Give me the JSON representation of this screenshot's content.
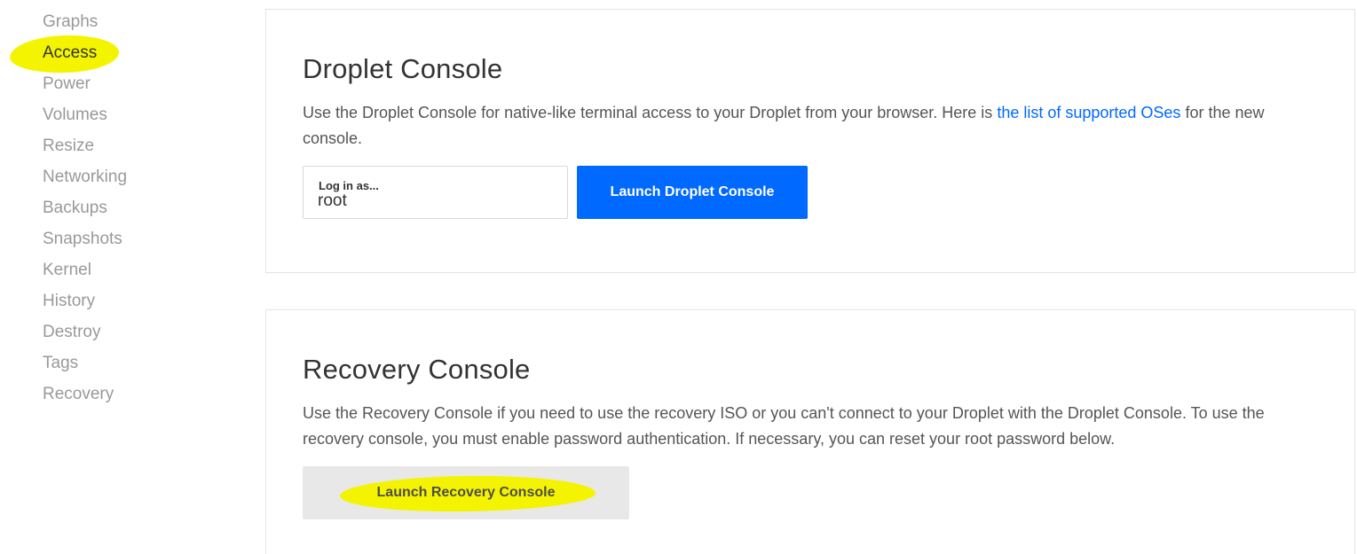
{
  "sidebar": {
    "items": [
      {
        "label": "Graphs"
      },
      {
        "label": "Access"
      },
      {
        "label": "Power"
      },
      {
        "label": "Volumes"
      },
      {
        "label": "Resize"
      },
      {
        "label": "Networking"
      },
      {
        "label": "Backups"
      },
      {
        "label": "Snapshots"
      },
      {
        "label": "Kernel"
      },
      {
        "label": "History"
      },
      {
        "label": "Destroy"
      },
      {
        "label": "Tags"
      },
      {
        "label": "Recovery"
      }
    ],
    "active": "Access"
  },
  "droplet_console": {
    "title": "Droplet Console",
    "description_before": "Use the Droplet Console for native-like terminal access to your Droplet from your browser. Here is ",
    "link_text": "the list of supported OSes",
    "description_after": " for the new console.",
    "login_label": "Log in as...",
    "login_value": "root",
    "launch_button": "Launch Droplet Console"
  },
  "recovery_console": {
    "title": "Recovery Console",
    "description": "Use the Recovery Console if you need to use the recovery ISO or you can't connect to your Droplet with the Droplet Console. To use the recovery console, you must enable password authentication. If necessary, you can reset your root password below.",
    "launch_button": "Launch Recovery Console"
  },
  "colors": {
    "primary": "#0069ff",
    "highlight": "#f4f400"
  }
}
